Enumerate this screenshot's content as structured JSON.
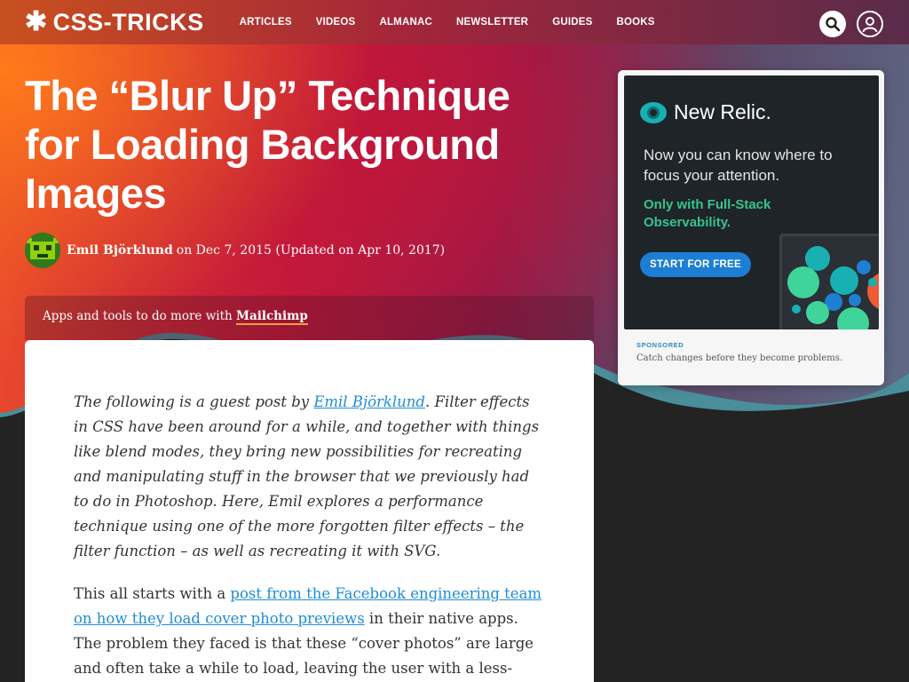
{
  "site": {
    "logo_text": "CSS-TRICKS",
    "logo_glyph": "✱",
    "nav": [
      "ARTICLES",
      "VIDEOS",
      "ALMANAC",
      "NEWSLETTER",
      "GUIDES",
      "BOOKS"
    ]
  },
  "article": {
    "title": "The “Blur Up” Technique for Loading Background Images",
    "author": "Emil Björklund",
    "date_text": "on Dec 7, 2015 (Updated on Apr 10, 2017)"
  },
  "promo": {
    "text": "Apps and tools to do more with ",
    "brand": "Mailchimp"
  },
  "body": {
    "p1_a": "The following is a guest post by ",
    "p1_link": "Emil Björklund",
    "p1_b": ". Filter effects in CSS have been around for a while, and together with things like blend modes, they bring new possibilities for recreating and manipulating stuff in the browser that we previously had to do in Photoshop. Here, Emil explores a performance technique using one of the more forgotten filter effects – the filter function – as well as recreating it with SVG.",
    "p2_a": "This all starts with a ",
    "p2_link": "post from the Facebook engineering team on how they load cover photo previews",
    "p2_b": " in their native apps. The problem they faced is that these “cover photos” are large and often take a while to load, leaving the user with a less-than-ideal"
  },
  "ad": {
    "brand": "New Relic.",
    "headline": "Now you can know where to focus your attention.",
    "subhead": "Only with Full-Stack Observability.",
    "cta": "START FOR FREE",
    "sponsored_label": "SPONSORED",
    "tagline": "Catch changes before they become problems."
  },
  "colors": {
    "link": "#1f8dd6",
    "ad_cta": "#1c7fd4",
    "ad_green": "#35c48f",
    "dark_bg": "#232323"
  }
}
